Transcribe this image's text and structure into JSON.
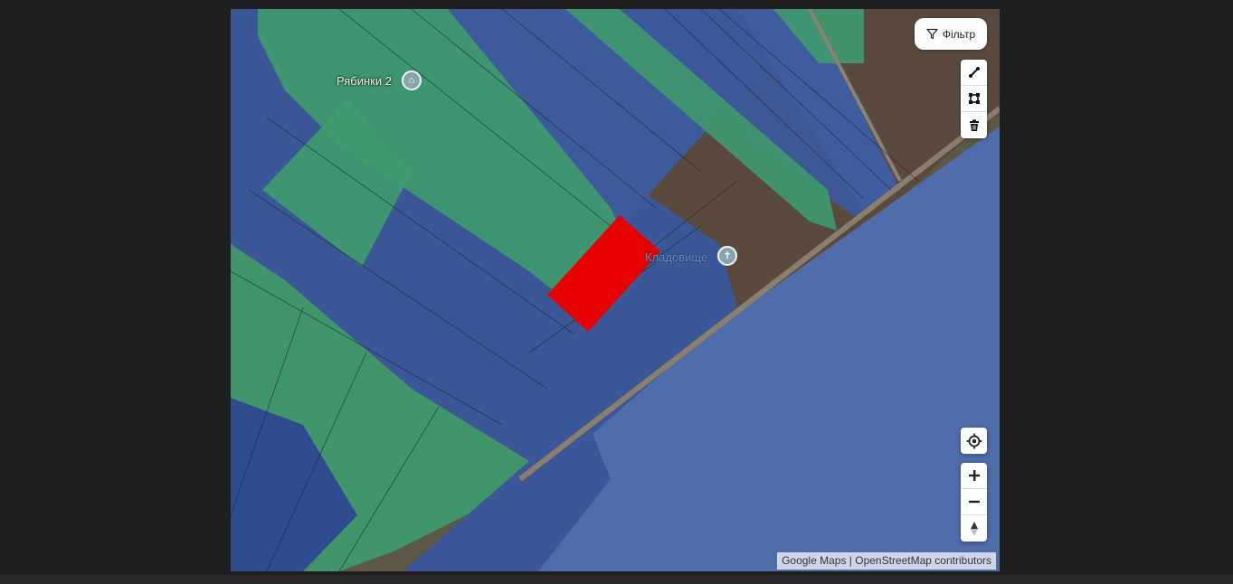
{
  "map": {
    "place_labels": [
      "Рябинки 2",
      "Кладовище"
    ],
    "highlight_color": "#e60000",
    "zone_colors": {
      "agricultural": "#3f5c9a",
      "residential": "#3f9a6e"
    }
  },
  "controls": {
    "filter_label": "Фільтр",
    "draw_tools": [
      "line-draw-icon",
      "polygon-draw-icon",
      "trash-icon"
    ],
    "geolocate": "crosshair-icon",
    "zoom": [
      "plus-icon",
      "minus-icon",
      "compass-icon"
    ]
  },
  "attribution": {
    "google": "Google Maps",
    "separator": " | ",
    "osm": "OpenStreetMap contributors"
  }
}
